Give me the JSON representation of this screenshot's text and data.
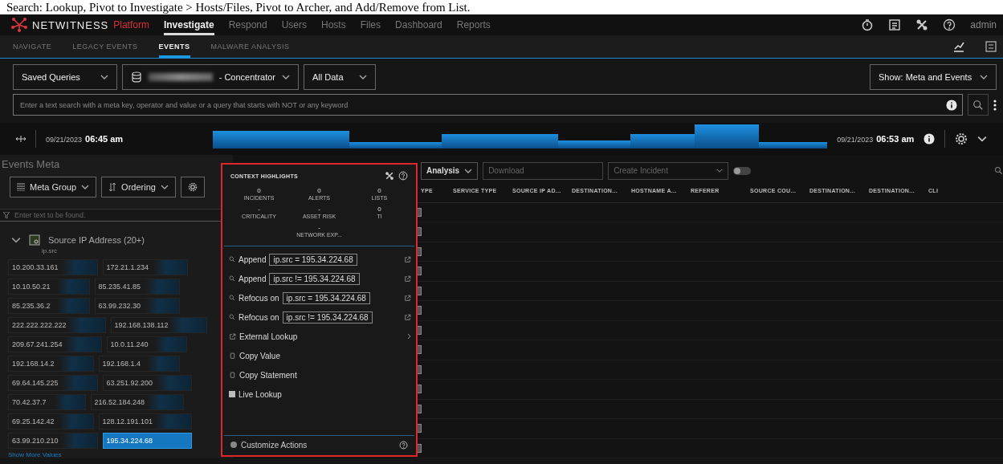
{
  "caption": "Search: Lookup, Pivot to Investigate > Hosts/Files, Pivot to Archer, and Add/Remove from List.",
  "header": {
    "brand": "NETWITNESS",
    "product": "Platform",
    "user": "admin",
    "tabs": [
      {
        "label": "Investigate",
        "selected": true
      },
      {
        "label": "Respond",
        "selected": false
      },
      {
        "label": "Users",
        "selected": false
      },
      {
        "label": "Hosts",
        "selected": false
      },
      {
        "label": "Files",
        "selected": false
      },
      {
        "label": "Dashboard",
        "selected": false
      },
      {
        "label": "Reports",
        "selected": false
      }
    ]
  },
  "subnav": {
    "tabs": [
      {
        "label": "NAVIGATE",
        "selected": false
      },
      {
        "label": "LEGACY EVENTS",
        "selected": false
      },
      {
        "label": "EVENTS",
        "selected": true
      },
      {
        "label": "MALWARE ANALYSIS",
        "selected": false
      }
    ]
  },
  "query": {
    "saved_queries": "Saved Queries",
    "service": "- Concentrator",
    "time_range": "All Data",
    "view": "Show: Meta and Events",
    "search": {
      "placeholder": "Enter a text search with a meta key, operator and value or a query that starts with NOT or any keyword"
    }
  },
  "timeline": {
    "start_date": "09/21/2023",
    "start_time": "06:45 am",
    "end_date": "09/21/2023",
    "end_time": "06:53 am"
  },
  "meta_panel": {
    "title": "Events Meta",
    "buttons": [
      "Meta Group",
      "Ordering"
    ],
    "filter": {
      "placeholder": "Enter text to be found."
    },
    "group": {
      "title": "Source IP Address (20+)",
      "key": "ip.src",
      "expanded": true,
      "more": "Show More Values",
      "values": [
        {
          "value": "10.200.33.161",
          "selected": false
        },
        {
          "value": "172.21.1.234",
          "selected": false
        },
        {
          "value": "10.10.50.21",
          "selected": false
        },
        {
          "value": "85.235.41.85",
          "selected": false
        },
        {
          "value": "85.235.36.2",
          "selected": false
        },
        {
          "value": "63.99.232.30",
          "selected": false
        },
        {
          "value": "222.222.222.222",
          "selected": false
        },
        {
          "value": "192.168.138.112",
          "selected": false
        },
        {
          "value": "209.67.241.254",
          "selected": false
        },
        {
          "value": "10.0.11.240",
          "selected": false
        },
        {
          "value": "192.168.14.2",
          "selected": false
        },
        {
          "value": "192.168.1.4",
          "selected": false
        },
        {
          "value": "69.64.145.225",
          "selected": false
        },
        {
          "value": "63.251.92.200",
          "selected": false
        },
        {
          "value": "70.42.37.7",
          "selected": false
        },
        {
          "value": "216.52.184.248",
          "selected": false
        },
        {
          "value": "69.25.142.42",
          "selected": false
        },
        {
          "value": "128.12.191.101",
          "selected": false
        },
        {
          "value": "63.99.210.210",
          "selected": false
        },
        {
          "value": "195.34.224.68",
          "selected": true
        }
      ]
    }
  },
  "events": {
    "toolbar": {
      "analysis": "Analysis",
      "download": "Download",
      "incident": "Create Incident",
      "toggle_on": false
    },
    "columns": [
      "YPE",
      "SERVICE TYPE",
      "SOURCE IP AD...",
      "DESTINATION...",
      "HOSTNAME A...",
      "REFERER",
      "SOURCE COU...",
      "DESTINATION...",
      "DESTINATION...",
      "CLI"
    ]
  },
  "context_menu": {
    "title": "CONTEXT HIGHLIGHTS",
    "stats": [
      {
        "value": "0",
        "label": "INCIDENTS"
      },
      {
        "value": "0",
        "label": "ALERTS"
      },
      {
        "value": "0",
        "label": "LISTS"
      },
      {
        "value": "-",
        "label": "CRITICALITY"
      },
      {
        "value": "-",
        "label": "ASSET RISK"
      },
      {
        "value": "0",
        "label": "TI"
      },
      {
        "value": "-",
        "label": "NETWORK EXP..."
      }
    ],
    "actions": [
      {
        "kind": "query",
        "verb": "Append",
        "query": "ip.src = 195.34.224.68"
      },
      {
        "kind": "query",
        "verb": "Append",
        "query": "ip.src != 195.34.224.68"
      },
      {
        "kind": "query",
        "verb": "Refocus on",
        "query": "ip.src = 195.34.224.68"
      },
      {
        "kind": "query",
        "verb": "Refocus on",
        "query": "ip.src != 195.34.224.68"
      },
      {
        "kind": "submenu",
        "label": "External Lookup"
      },
      {
        "kind": "copy",
        "label": "Copy Value"
      },
      {
        "kind": "copy",
        "label": "Copy Statement"
      },
      {
        "kind": "lookup",
        "label": "Live Lookup"
      }
    ],
    "footer": "Customize Actions"
  }
}
